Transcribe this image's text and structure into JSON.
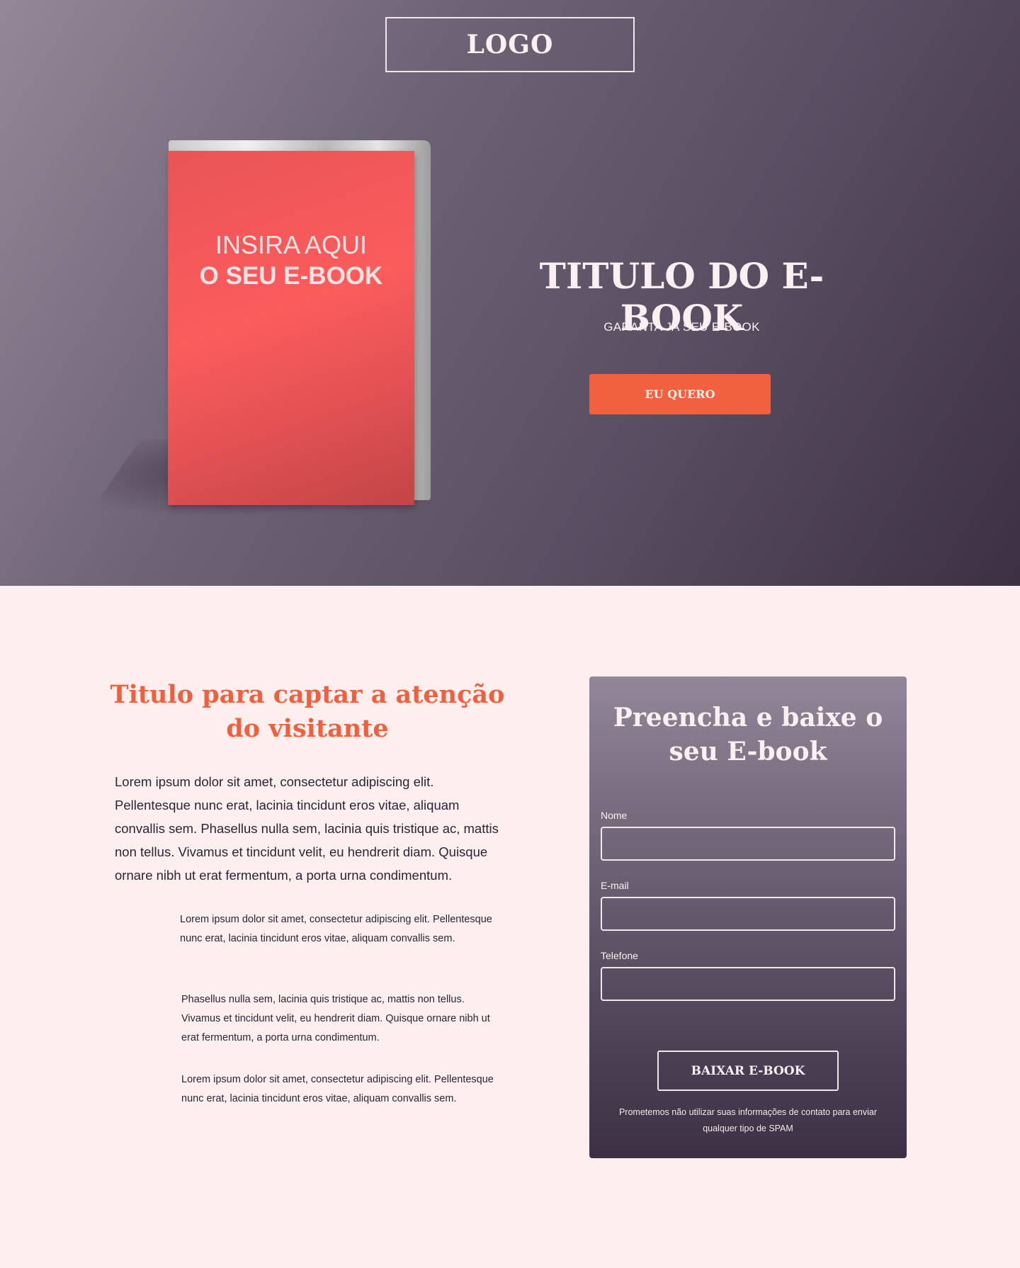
{
  "hero": {
    "logo": "LOGO",
    "book_cover_line1": "INSIRA AQUI",
    "book_cover_line2": "O SEU E-BOOK",
    "title": "TITULO DO E-BOOK",
    "subtitle": "GARANTA JA SEU E-BOOK",
    "cta_label": "EU QUERO",
    "colors": {
      "accent": "#f1603f",
      "gradient_start": "#938798",
      "gradient_end": "#3d3043"
    }
  },
  "content": {
    "title": "Titulo para captar a atenção do visitante",
    "lead": "Lorem ipsum dolor sit amet, consectetur adipiscing elit. Pellentesque nunc erat, lacinia tincidunt eros vitae, aliquam convallis sem. Phasellus nulla sem, lacinia quis tristique ac, mattis non tellus. Vivamus et tincidunt velit, eu hendrerit diam. Quisque ornare nibh ut erat fermentum, a porta urna condimentum.",
    "paragraphs": [
      "Lorem ipsum dolor sit amet, consectetur adipiscing elit. Pellentesque nunc erat, lacinia tincidunt eros vitae, aliquam convallis sem.",
      "Phasellus nulla sem, lacinia quis tristique ac, mattis non tellus. Vivamus et tincidunt velit, eu hendrerit diam. Quisque ornare nibh ut erat fermentum, a porta urna condimentum.",
      "Lorem ipsum dolor sit amet, consectetur adipiscing elit. Pellentesque nunc erat, lacinia tincidunt eros vitae, aliquam convallis sem."
    ],
    "colors": {
      "title": "#f0603f",
      "background": "#fcefee"
    }
  },
  "form": {
    "title": "Preencha e baixe o seu E-book",
    "fields": [
      {
        "label": "Nome",
        "value": "",
        "placeholder": ""
      },
      {
        "label": "E-mail",
        "value": "",
        "placeholder": ""
      },
      {
        "label": "Telefone",
        "value": "",
        "placeholder": ""
      }
    ],
    "submit_label": "BAIXAR E-BOOK",
    "note": "Prometemos não utilizar suas informações de contato para enviar qualquer tipo de SPAM"
  }
}
